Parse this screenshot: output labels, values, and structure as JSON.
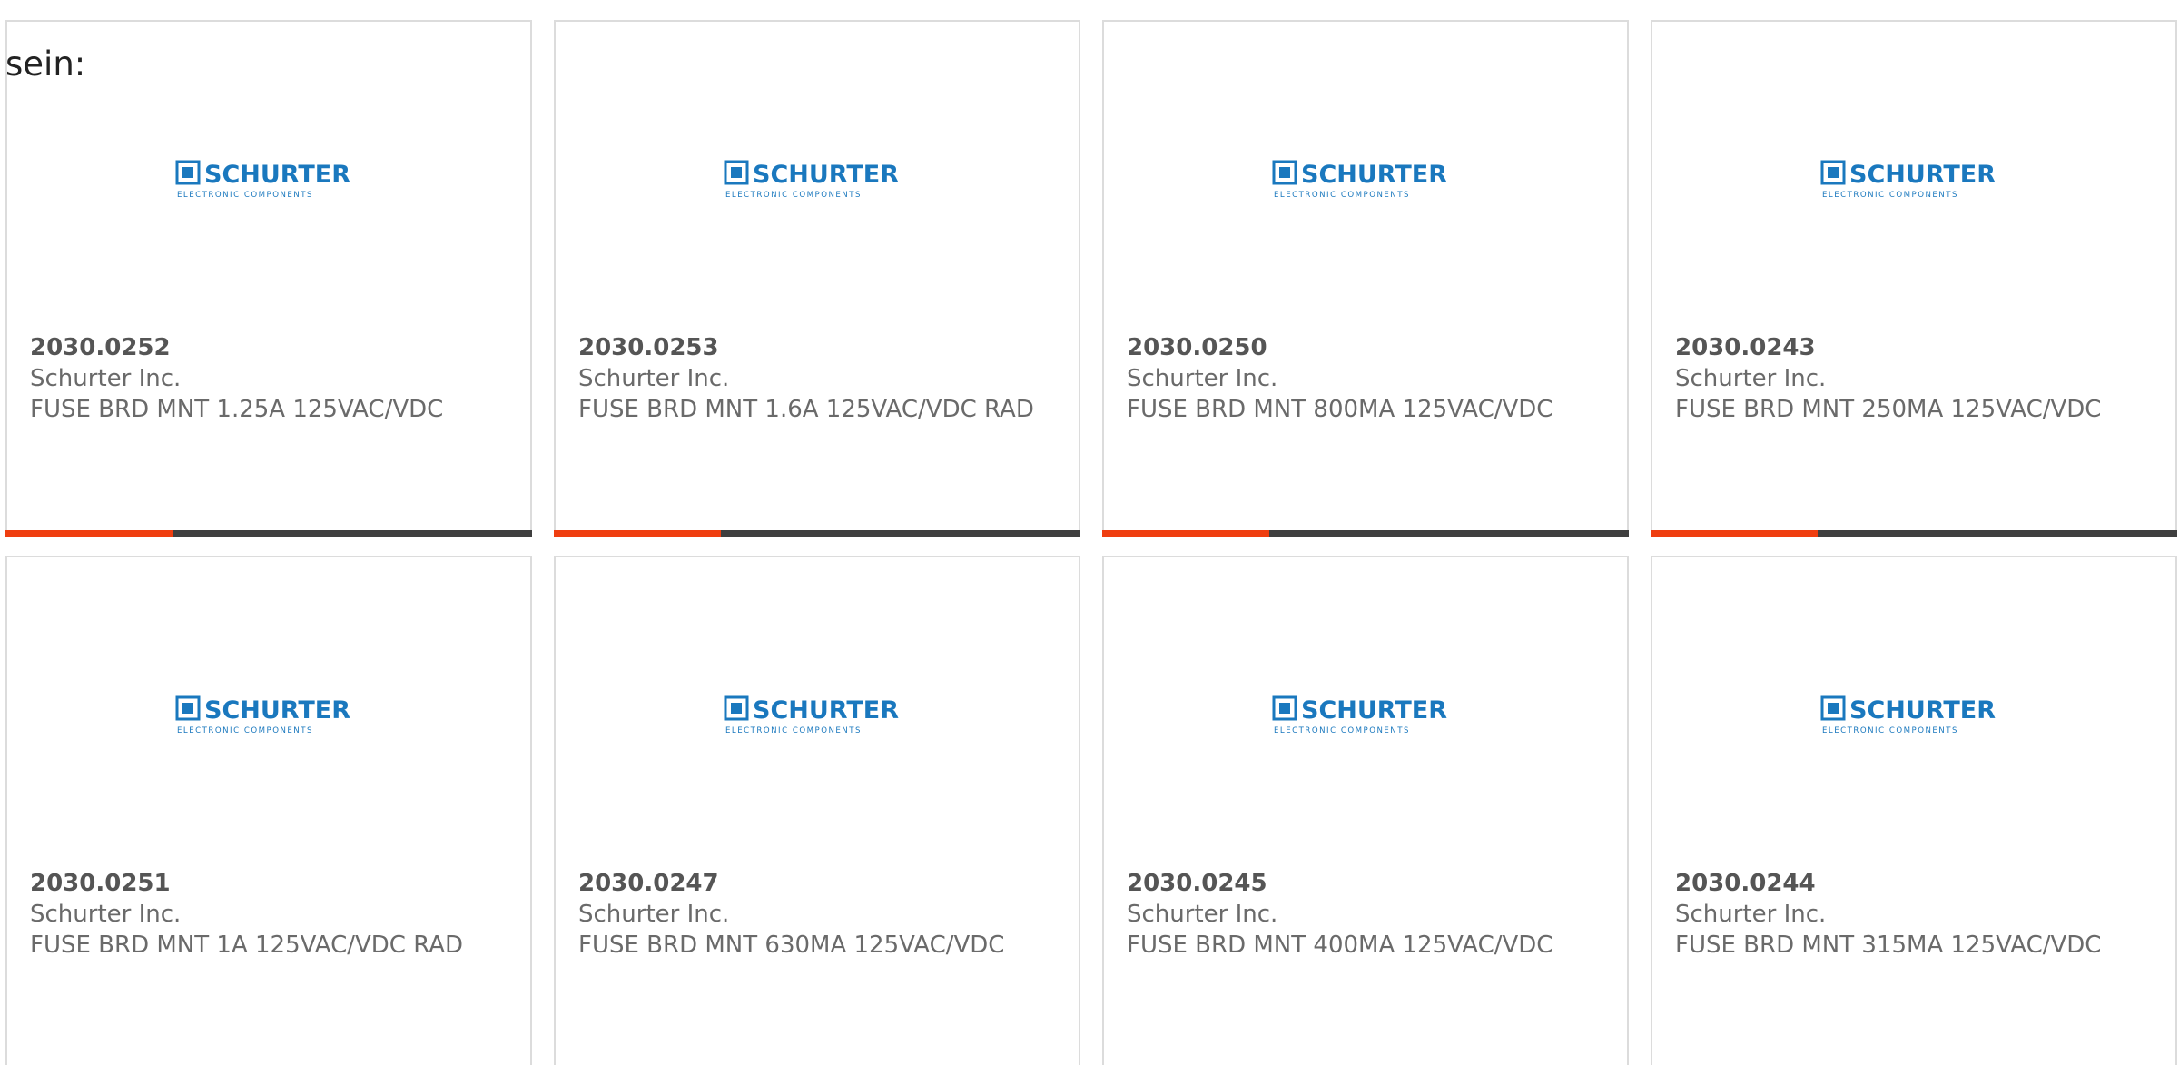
{
  "intro_text": "sein:",
  "colors": {
    "accent": "#ef3e10",
    "bar_dark": "#3f3f3f",
    "logo_blue": "#1a78be",
    "text_gray": "#6a6a6a"
  },
  "logo": {
    "brand": "SCHURTER",
    "tagline": "ELECTRONIC COMPONENTS",
    "icon": "schurter-logo-icon"
  },
  "products": [
    {
      "part_number": "2030.0252",
      "manufacturer": "Schurter Inc.",
      "description": "FUSE BRD MNT 1.25A 125VAC/VDC"
    },
    {
      "part_number": "2030.0253",
      "manufacturer": "Schurter Inc.",
      "description": "FUSE BRD MNT 1.6A 125VAC/VDC RAD"
    },
    {
      "part_number": "2030.0250",
      "manufacturer": "Schurter Inc.",
      "description": "FUSE BRD MNT 800MA 125VAC/VDC"
    },
    {
      "part_number": "2030.0243",
      "manufacturer": "Schurter Inc.",
      "description": "FUSE BRD MNT 250MA 125VAC/VDC"
    },
    {
      "part_number": "2030.0251",
      "manufacturer": "Schurter Inc.",
      "description": "FUSE BRD MNT 1A 125VAC/VDC RAD"
    },
    {
      "part_number": "2030.0247",
      "manufacturer": "Schurter Inc.",
      "description": "FUSE BRD MNT 630MA 125VAC/VDC"
    },
    {
      "part_number": "2030.0245",
      "manufacturer": "Schurter Inc.",
      "description": "FUSE BRD MNT 400MA 125VAC/VDC"
    },
    {
      "part_number": "2030.0244",
      "manufacturer": "Schurter Inc.",
      "description": "FUSE BRD MNT 315MA 125VAC/VDC"
    }
  ]
}
